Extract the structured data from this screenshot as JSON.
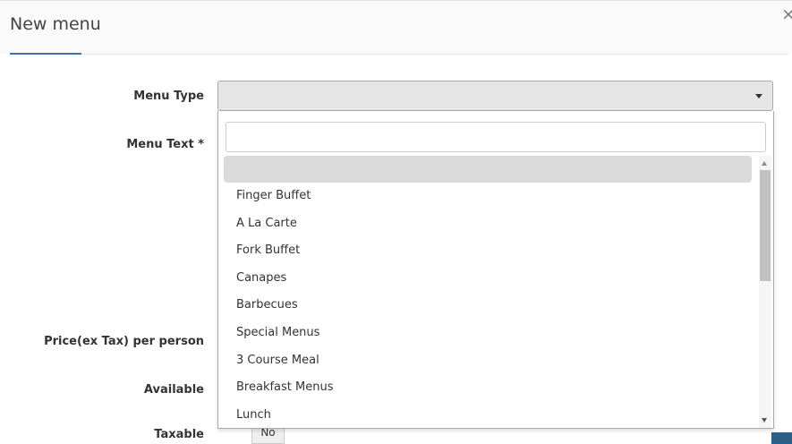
{
  "modal": {
    "title": "New menu",
    "close_symbol": "×"
  },
  "form": {
    "menu_type_label": "Menu Type",
    "menu_text_label": "Menu Text *",
    "price_label": "Price(ex Tax) per person",
    "available_label": "Available",
    "taxable_label": "Taxable",
    "taxable_no": "No",
    "menu_type_value": ""
  },
  "dropdown": {
    "search_value": "",
    "options": [
      "",
      "Finger Buffet",
      "A La Carte",
      "Fork Buffet",
      "Canapes",
      "Barbecues",
      "Special Menus",
      "3 Course Meal",
      "Breakfast Menus",
      "Lunch"
    ]
  },
  "icons": {
    "close": "close-icon",
    "select_arrow": "chevron-down-icon",
    "scroll_up": "scroll-up-arrow-icon",
    "scroll_down": "scroll-down-arrow-icon"
  }
}
